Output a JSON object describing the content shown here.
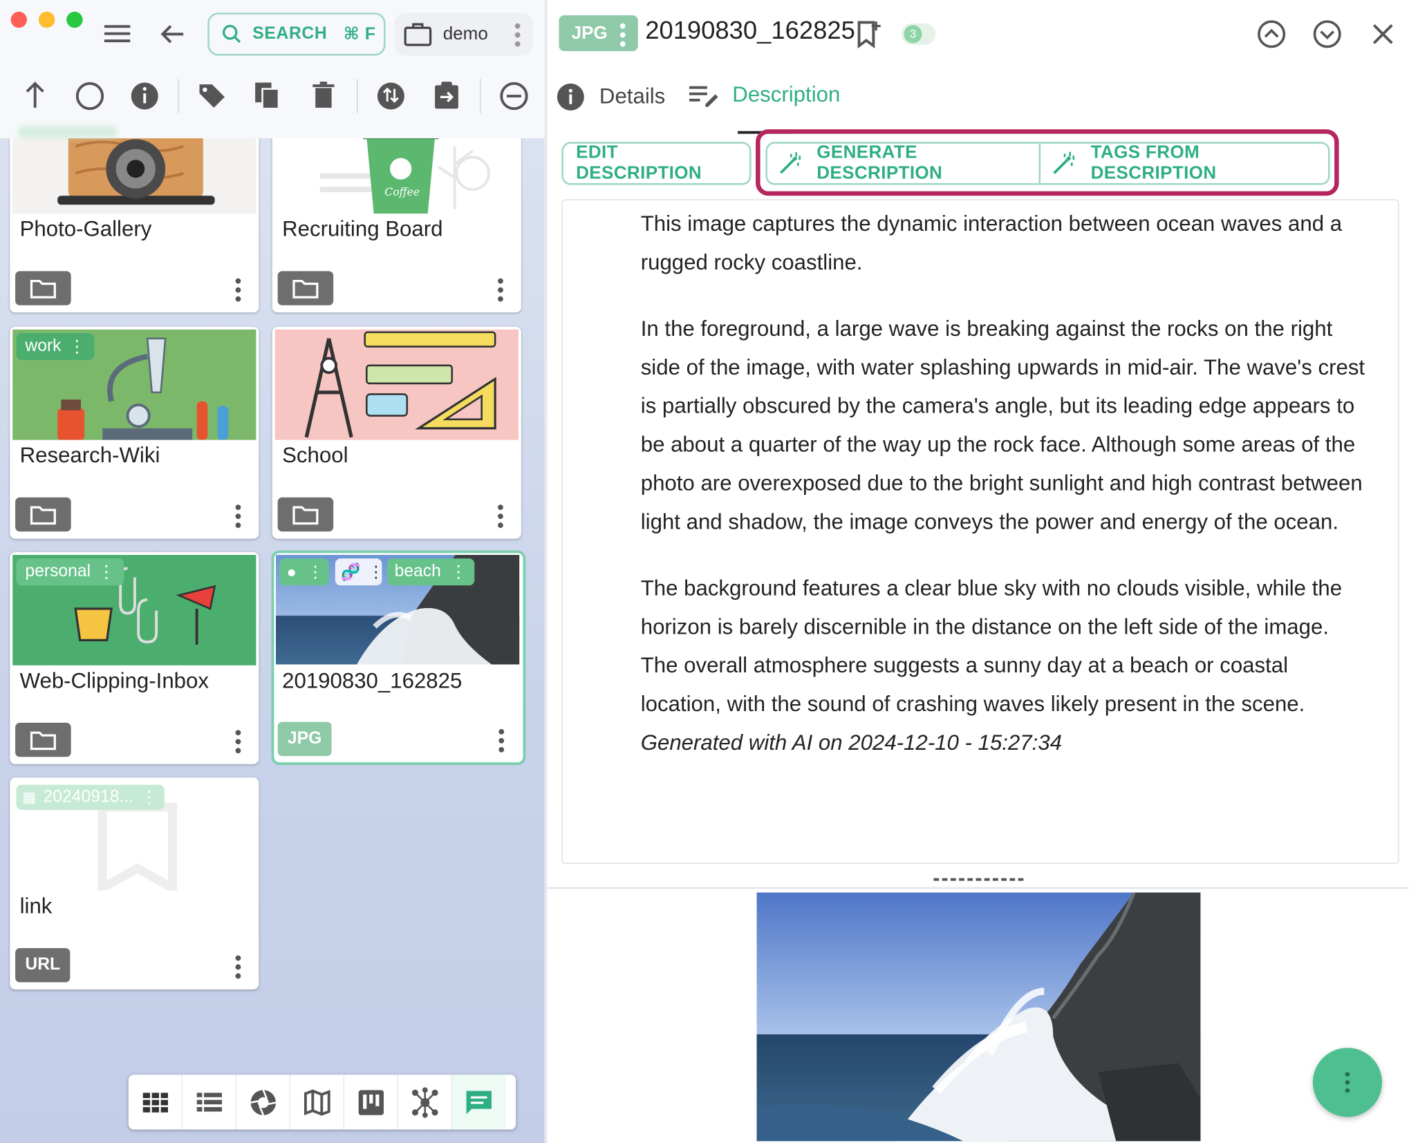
{
  "toolbar": {
    "search_label": "SEARCH",
    "search_shortcut": "⌘ F",
    "location_name": "demo"
  },
  "cards": [
    {
      "title": "Photo-Gallery",
      "tag": ""
    },
    {
      "title": "Recruiting Board",
      "tag": ""
    },
    {
      "title": "Research-Wiki",
      "tag": "work"
    },
    {
      "title": "School",
      "tag": ""
    },
    {
      "title": "Web-Clipping-Inbox",
      "tag": "personal"
    },
    {
      "title": "20190830_162825",
      "tag": "beach",
      "type": "JPG"
    },
    {
      "title": "link",
      "tag": "20240918...",
      "type": "URL"
    }
  ],
  "viewer": {
    "file_type": "JPG",
    "file_name": "20190830_162825",
    "tag_count": "3",
    "tabs": {
      "details": "Details",
      "description": "Description"
    },
    "buttons": {
      "edit": "EDIT DESCRIPTION",
      "generate": "GENERATE DESCRIPTION",
      "tags": "TAGS FROM DESCRIPTION"
    },
    "description": {
      "p1": "This image captures the dynamic interaction between ocean waves and a rugged rocky coastline.",
      "p2": "In the foreground, a large wave is breaking against the rocks on the right side of the image, with water splashing upwards in mid-air. The wave's crest is partially obscured by the camera's angle, but its leading edge appears to be about a quarter of the way up the rock face. Although some areas of the photo are overexposed due to the bright sunlight and high contrast between light and shadow, the image conveys the power and energy of the ocean.",
      "p3": "The background features a clear blue sky with no clouds visible, while the horizon is barely discernible in the distance on the left side of the image. The overall atmosphere suggests a sunny day at a beach or coastal location, with the sound of crashing waves likely present in the scene.",
      "generated": "Generated with AI on 2024-12-10 - 15:27:34"
    }
  },
  "colors": {
    "accent": "#2fae83",
    "highlight": "#b5265e"
  }
}
